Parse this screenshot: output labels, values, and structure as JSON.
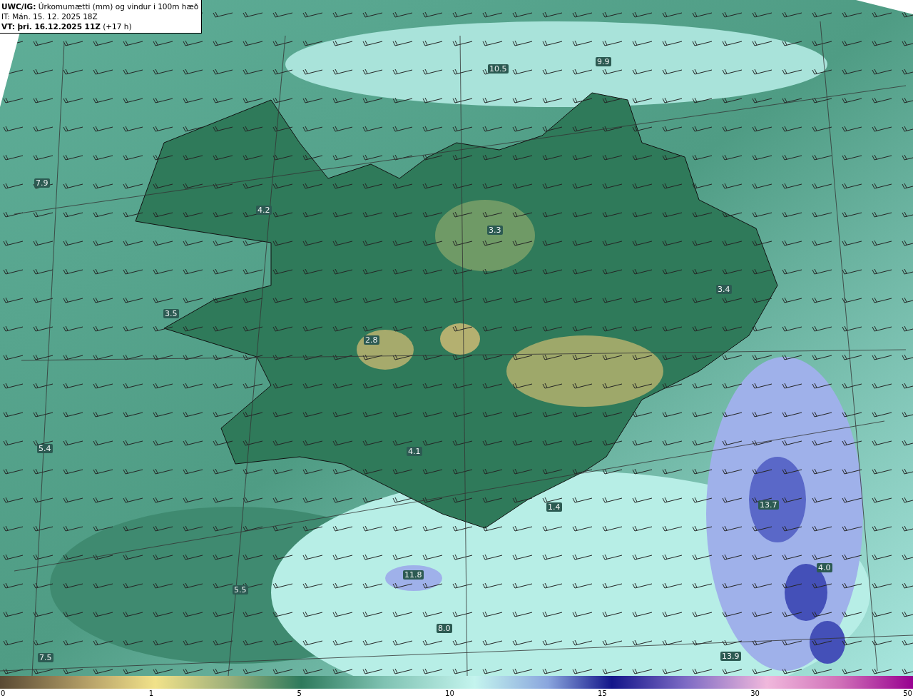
{
  "header": {
    "title": "**UWC/IG:** Úrkomumætti (mm) og vindur i 100m hæð",
    "issue_time": "IT: Mán. 15. 12. 2025 18Z",
    "valid_time": "**VT: þri. 16.12.2025 11Z** (+17 h)"
  },
  "map_labels": [
    {
      "text": "10.5"
    },
    {
      "text": "9.9"
    },
    {
      "text": "7.9"
    },
    {
      "text": "4.2"
    },
    {
      "text": "3.3"
    },
    {
      "text": "3.4"
    },
    {
      "text": "3.5"
    },
    {
      "text": "2.8"
    },
    {
      "text": "5.4"
    },
    {
      "text": "4.1"
    },
    {
      "text": "1.4"
    },
    {
      "text": "13.7"
    },
    {
      "text": "11.8"
    },
    {
      "text": "4.0"
    },
    {
      "text": "5.5"
    },
    {
      "text": "8.0"
    },
    {
      "text": "13.9"
    },
    {
      "text": "7.5"
    }
  ],
  "colorbar": {
    "ticks": [
      "0",
      "1",
      "5",
      "10",
      "15",
      "30",
      "50"
    ]
  }
}
